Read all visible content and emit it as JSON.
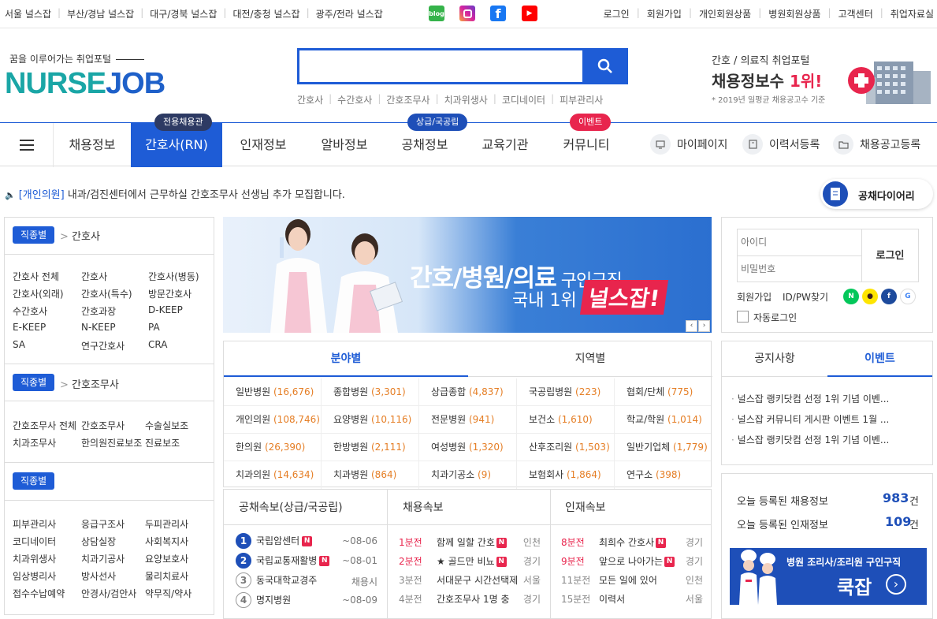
{
  "top_bar": {
    "regions": [
      "서울 널스잡",
      "부산/경남 널스잡",
      "대구/경북 널스잡",
      "대전/충청 널스잡",
      "광주/전라 널스잡"
    ],
    "social": [
      {
        "name": "blog",
        "label": "blog",
        "color": "#35b34a"
      },
      {
        "name": "instagram",
        "label": "",
        "color": "#d6249f"
      },
      {
        "name": "facebook",
        "label": "f",
        "color": "#1877f2"
      },
      {
        "name": "youtube",
        "label": "▶",
        "color": "#ff0000"
      }
    ],
    "links": [
      "로그인",
      "회원가입",
      "개인회원상품",
      "병원회원상품",
      "고객센터",
      "취업자료실"
    ]
  },
  "header": {
    "tagline": "꿈을 이루어가는 취업포털",
    "logo_part1": "NURSE",
    "logo_part2": "JOB",
    "search_placeholder": "",
    "search_links": [
      "간호사",
      "수간호사",
      "간호조무사",
      "치과위생사",
      "코디네이터",
      "피부관리사"
    ],
    "promo_line1": "간호 / 의료직 취업포털",
    "promo_line2_a": "채용정보수 ",
    "promo_line2_b": "1위!",
    "promo_line3": "* 2019년 일평균 채용공고수 기준"
  },
  "nav": {
    "items": [
      "채용정보",
      "간호사(RN)",
      "인재정보",
      "알바정보",
      "공채정보",
      "교육기관",
      "커뮤니티"
    ],
    "badges": [
      "전용채용관",
      "상급/국공립",
      "이벤트"
    ],
    "right": [
      "마이페이지",
      "이력서등록",
      "채용공고등록"
    ]
  },
  "notice": {
    "tag": "[개인의원]",
    "text": " 내과/검진센터에서 근무하실 간호조무사 선생님 추가 모집합니다.",
    "diary": "공채다이어리"
  },
  "jobs": {
    "badge": "직종별",
    "nurse_title": "간호사",
    "nurse_items": [
      "간호사 전체",
      "간호사",
      "간호사(병동)",
      "간호사(외래)",
      "간호사(특수)",
      "방문간호사",
      "수간호사",
      "간호과장",
      "D-KEEP",
      "E-KEEP",
      "N-KEEP",
      "PA",
      "SA",
      "연구간호사",
      "CRA"
    ],
    "assist_title": "간호조무사",
    "assist_items": [
      "간호조무사 전체",
      "간호조무사",
      "수술실보조",
      "치과조무사",
      "한의원진료보조",
      "진료보조"
    ],
    "other_items": [
      "피부관리사",
      "응급구조사",
      "두피관리사",
      "코디네이터",
      "상담실장",
      "사회복지사",
      "치과위생사",
      "치과기공사",
      "요양보호사",
      "임상병리사",
      "방사선사",
      "물리치료사",
      "접수수납예약",
      "안경사/검안사",
      "약무직/약사"
    ]
  },
  "banner": {
    "title": "간호/병원/의료",
    "title_suffix": " 구인구직",
    "sub": "국내 1위",
    "brand": "널스잡!"
  },
  "fields": {
    "tabs": [
      "분야별",
      "지역별"
    ],
    "cells": [
      {
        "name": "일반병원",
        "count": "(16,676)"
      },
      {
        "name": "종합병원",
        "count": "(3,301)"
      },
      {
        "name": "상급종합",
        "count": "(4,837)"
      },
      {
        "name": "국공립병원",
        "count": "(223)"
      },
      {
        "name": "협회/단체",
        "count": "(775)"
      },
      {
        "name": "개인의원",
        "count": "(108,746)"
      },
      {
        "name": "요양병원",
        "count": "(10,116)"
      },
      {
        "name": "전문병원",
        "count": "(941)"
      },
      {
        "name": "보건소",
        "count": "(1,610)"
      },
      {
        "name": "학교/학원",
        "count": "(1,014)"
      },
      {
        "name": "한의원",
        "count": "(26,390)"
      },
      {
        "name": "한방병원",
        "count": "(2,111)"
      },
      {
        "name": "여성병원",
        "count": "(1,320)"
      },
      {
        "name": "산후조리원",
        "count": "(1,503)"
      },
      {
        "name": "일반기업체",
        "count": "(1,779)"
      },
      {
        "name": "치과의원",
        "count": "(14,634)"
      },
      {
        "name": "치과병원",
        "count": "(864)"
      },
      {
        "name": "치과기공소",
        "count": "(9)"
      },
      {
        "name": "보험회사",
        "count": "(1,864)"
      },
      {
        "name": "연구소",
        "count": "(398)"
      }
    ]
  },
  "news": {
    "gongchae_title": "공채속보(상급/국공립)",
    "gongchae": [
      {
        "num": "1",
        "name": "국립암센터",
        "new": "N",
        "date": "~08-06"
      },
      {
        "num": "2",
        "name": "국립교통재활병",
        "new": "N",
        "date": "~08-01"
      },
      {
        "num": "3",
        "name": "동국대학교경주",
        "new": "",
        "date": "채용시"
      },
      {
        "num": "4",
        "name": "명지병원",
        "new": "",
        "date": "~08-09"
      }
    ],
    "hire_title": "채용속보",
    "hire": [
      {
        "time": "1분전",
        "text": "함께 일할 간호",
        "new": "N",
        "loc": "인천"
      },
      {
        "time": "2분전",
        "text": "★ 골드만 비뇨",
        "new": "N",
        "loc": "경기"
      },
      {
        "time": "3분전",
        "text": "서대문구 시간선택제",
        "new": "",
        "loc": "서울"
      },
      {
        "time": "4분전",
        "text": "간호조무사 1명 충",
        "new": "",
        "loc": "경기"
      }
    ],
    "talent_title": "인재속보",
    "talent": [
      {
        "time": "8분전",
        "text": "최희수 간호사",
        "new": "N",
        "loc": "경기"
      },
      {
        "time": "9분전",
        "text": "앞으로 나아가는",
        "new": "N",
        "loc": "경기"
      },
      {
        "time": "11분전",
        "text": "모든 일에 있어",
        "new": "",
        "loc": "인천"
      },
      {
        "time": "15분전",
        "text": "이력서",
        "new": "",
        "loc": "서울"
      }
    ]
  },
  "login": {
    "id_placeholder": "아이디",
    "pw_placeholder": "비밀번호",
    "button": "로그인",
    "signup": "회원가입",
    "find": "ID/PW찾기",
    "auto": "자동로그인"
  },
  "notices": {
    "tabs": [
      "공지사항",
      "이벤트"
    ],
    "items": [
      "널스잡 랭키닷컴 선정 1위 기념 이벤...",
      "널스잡 커뮤니티 게시판 이벤트 1월 ...",
      "널스잡 랭키닷컴 선정 1위 기념 이벤..."
    ]
  },
  "stats": {
    "jobs_label": "오늘 등록된 채용정보",
    "jobs_count": "983",
    "talent_label": "오늘 등록된 인재정보",
    "talent_count": "109",
    "unit": "건",
    "cook_line1": "병원 조리사/조리원 구인구직",
    "cook_line2": "쿡잡"
  }
}
